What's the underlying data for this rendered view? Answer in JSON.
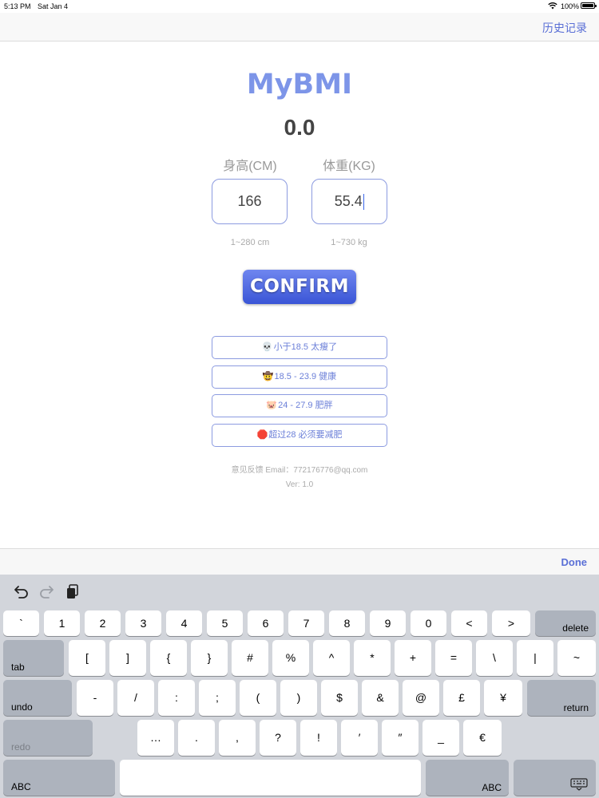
{
  "status_bar": {
    "time": "5:13 PM",
    "date": "Sat Jan 4",
    "battery": "100%"
  },
  "nav": {
    "history_label": "历史记录"
  },
  "app": {
    "title": "MyBMI",
    "bmi_value": "0.0"
  },
  "inputs": {
    "height_label": "身高(CM)",
    "weight_label": "体重(KG)",
    "height_value": "166",
    "weight_value": "55.4",
    "height_range": "1~280 cm",
    "weight_range": "1~730 kg"
  },
  "confirm_label": "CONFIRM",
  "categories": [
    {
      "emoji": "💀",
      "label": "小于18.5  太瘦了"
    },
    {
      "emoji": "🤠",
      "label": "18.5 - 23.9  健康"
    },
    {
      "emoji": "🐷",
      "label": "24 - 27.9  肥胖"
    },
    {
      "emoji": "🛑",
      "label": "超过28  必须要减肥"
    }
  ],
  "footer": {
    "feedback": "意见反馈 Email：772176776@qq.com",
    "version": "Ver: 1.0"
  },
  "accessory": {
    "done_label": "Done"
  },
  "keyboard": {
    "row1": [
      "`",
      "1",
      "2",
      "3",
      "4",
      "5",
      "6",
      "7",
      "8",
      "9",
      "0",
      "<",
      ">"
    ],
    "delete_label": "delete",
    "tab_label": "tab",
    "row2": [
      "[",
      "]",
      "{",
      "}",
      "#",
      "%",
      "^",
      "*",
      "+",
      "=",
      "\\",
      "|",
      "~"
    ],
    "undo_label": "undo",
    "row3": [
      "-",
      "/",
      ":",
      ";",
      "(",
      ")",
      "$",
      "&",
      "@",
      "£",
      "¥"
    ],
    "return_label": "return",
    "redo_label": "redo",
    "row4": [
      "…",
      ".",
      ",",
      "?",
      "!",
      "′",
      "″",
      "_",
      "€"
    ],
    "abc_left_label": "ABC",
    "abc_right_label": "ABC"
  }
}
